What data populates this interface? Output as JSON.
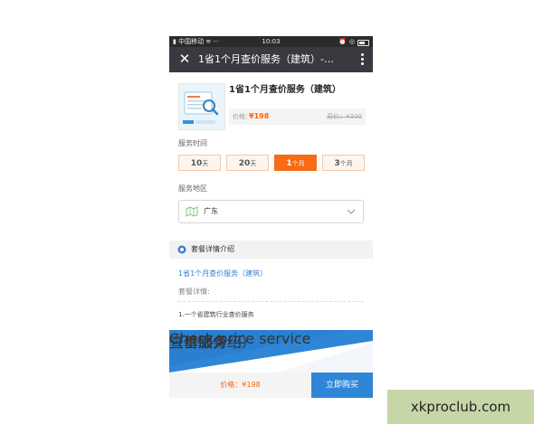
{
  "status_bar": {
    "carrier": "中国移动",
    "time": "10:03"
  },
  "nav": {
    "title": "1省1个月查价服务（建筑）-…"
  },
  "product": {
    "name": "1省1个月查价服务（建筑）",
    "price_label": "价格：",
    "price": "¥198",
    "original_price": "原价：¥300"
  },
  "service_time": {
    "label": "服务时间",
    "options": [
      {
        "num": "10",
        "unit": "天",
        "selected": false
      },
      {
        "num": "20",
        "unit": "天",
        "selected": false
      },
      {
        "num": "1",
        "unit": "个月",
        "selected": true
      },
      {
        "num": "3",
        "unit": "个月",
        "selected": false
      }
    ]
  },
  "service_area": {
    "label": "服务地区",
    "value": "广东"
  },
  "package": {
    "section_title": "套餐详情介绍",
    "link_text": "1省1个月查价服务（建筑）",
    "detail_label": "套餐详情:",
    "item": "1.一个省建筑行业查价服务"
  },
  "banner": {
    "title": "查价服务",
    "subtitle": "（基础介绍）",
    "english": "Check price service"
  },
  "bottom_bar": {
    "price": "价格：¥198",
    "buy_label": "立即购买"
  },
  "watermark": "xkproclub.com",
  "colors": {
    "accent_orange": "#f96a14",
    "price_orange": "#ff6600",
    "link_blue": "#3a7fd0",
    "buy_blue": "#2f86d6",
    "nav_bg": "#393a3f"
  }
}
